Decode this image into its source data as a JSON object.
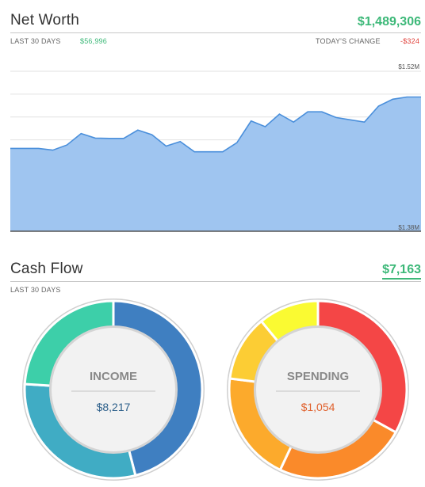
{
  "net_worth": {
    "title": "Net Worth",
    "value": "$1,489,306",
    "period_label": "LAST 30 DAYS",
    "period_change": "$56,996",
    "today_label": "TODAY'S CHANGE",
    "today_change": "-$324"
  },
  "cash_flow": {
    "title": "Cash Flow",
    "value": "$7,163",
    "period_label": "LAST 30 DAYS"
  },
  "chart_data": [
    {
      "type": "area",
      "title": "",
      "xlabel": "",
      "ylabel": "",
      "ylim": [
        1.38,
        1.52
      ],
      "y_tick_labels": [
        "$1.52M",
        "$1.38M"
      ],
      "grid": true,
      "fill_color": "#9fc5f0",
      "line_color": "#4a8fdb",
      "series": [
        {
          "values": [
            1.4525,
            1.4525,
            1.4525,
            1.451,
            1.4555,
            1.4655,
            1.4615,
            1.4612,
            1.4612,
            1.4685,
            1.4645,
            1.4545,
            1.4585,
            1.4495,
            1.4495,
            1.4495,
            1.4575,
            1.4765,
            1.4715,
            1.4825,
            1.4755,
            1.4845,
            1.4845,
            1.4795,
            1.4775,
            1.4755,
            1.4895,
            1.4955,
            1.4975,
            1.4975
          ]
        }
      ]
    },
    {
      "type": "pie",
      "name": "income",
      "center_label": "INCOME",
      "center_value": "$8,217",
      "value_color": "#2c5f8a",
      "slices": [
        {
          "share": 0.46,
          "color": "#3f7fc1"
        },
        {
          "share": 0.3,
          "color": "#40acc4"
        },
        {
          "share": 0.24,
          "color": "#3dcfa9"
        }
      ]
    },
    {
      "type": "pie",
      "name": "spending",
      "center_label": "SPENDING",
      "center_value": "$1,054",
      "value_color": "#e0612d",
      "slices": [
        {
          "share": 0.33,
          "color": "#f44646"
        },
        {
          "share": 0.24,
          "color": "#fa8a2a"
        },
        {
          "share": 0.2,
          "color": "#fcaa2c"
        },
        {
          "share": 0.12,
          "color": "#fccd34"
        },
        {
          "share": 0.11,
          "color": "#fafa32"
        }
      ]
    }
  ]
}
